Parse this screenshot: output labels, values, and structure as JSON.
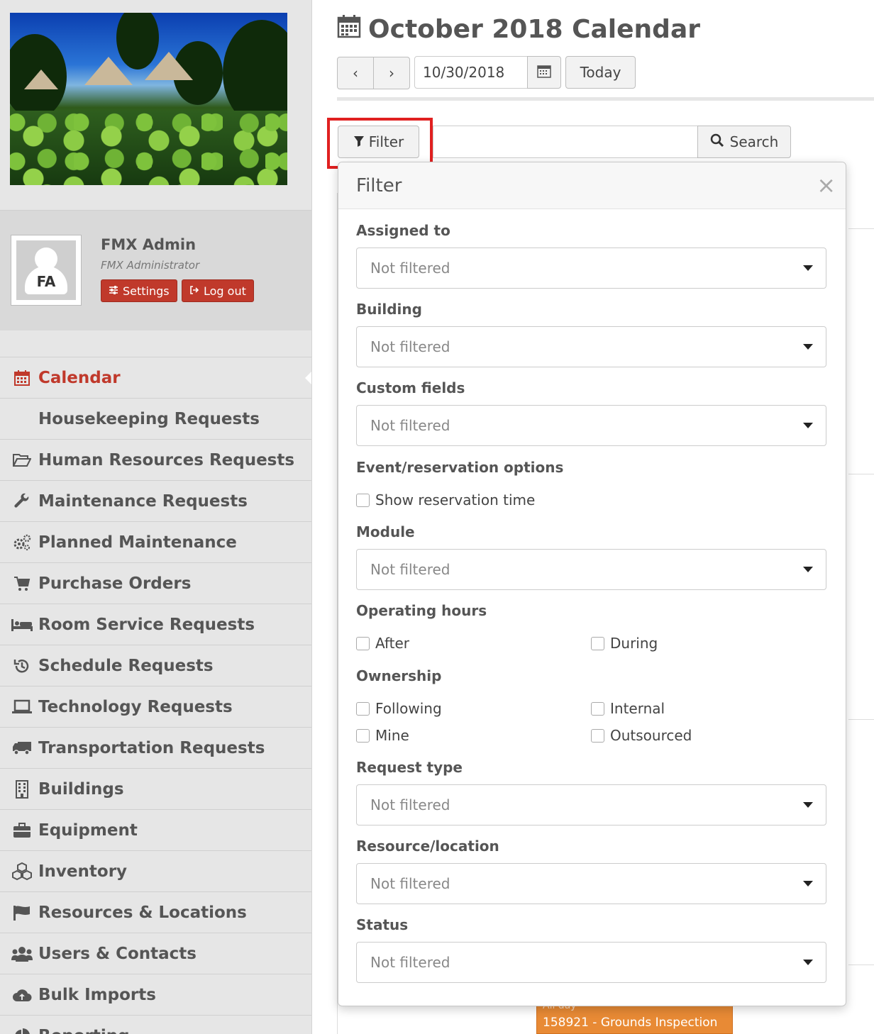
{
  "sidebar": {
    "user": {
      "initials": "FA",
      "name": "FMX Admin",
      "role": "FMX Administrator",
      "settings_label": "Settings",
      "logout_label": "Log out"
    },
    "nav": [
      {
        "label": "Calendar",
        "icon": "calendar-icon",
        "active": true
      },
      {
        "label": "Housekeeping Requests",
        "icon": "none",
        "sub": true
      },
      {
        "label": "Human Resources Requests",
        "icon": "folder-open-icon"
      },
      {
        "label": "Maintenance Requests",
        "icon": "wrench-icon"
      },
      {
        "label": "Planned Maintenance",
        "icon": "gears-icon"
      },
      {
        "label": "Purchase Orders",
        "icon": "cart-icon"
      },
      {
        "label": "Room Service Requests",
        "icon": "bed-icon"
      },
      {
        "label": "Schedule Requests",
        "icon": "history-icon"
      },
      {
        "label": "Technology Requests",
        "icon": "laptop-icon"
      },
      {
        "label": "Transportation Requests",
        "icon": "truck-icon"
      },
      {
        "label": "Buildings",
        "icon": "building-icon"
      },
      {
        "label": "Equipment",
        "icon": "briefcase-icon"
      },
      {
        "label": "Inventory",
        "icon": "cubes-icon"
      },
      {
        "label": "Resources & Locations",
        "icon": "flag-icon"
      },
      {
        "label": "Users & Contacts",
        "icon": "users-icon"
      },
      {
        "label": "Bulk Imports",
        "icon": "cloud-upload-icon"
      },
      {
        "label": "Reporting",
        "icon": "pie-chart-icon"
      }
    ]
  },
  "header": {
    "title": "October 2018 Calendar",
    "prev_label": "‹",
    "next_label": "›",
    "date_value": "10/30/2018",
    "today_label": "Today"
  },
  "toolbar": {
    "filter_label": "Filter",
    "search_label": "Search"
  },
  "filter_panel": {
    "title": "Filter",
    "close_label": "×",
    "assigned_to": {
      "label": "Assigned to",
      "value": "Not filtered"
    },
    "building": {
      "label": "Building",
      "value": "Not filtered"
    },
    "custom_fields": {
      "label": "Custom fields",
      "value": "Not filtered"
    },
    "event_options": {
      "label": "Event/reservation options",
      "show_reservation_time": "Show reservation time"
    },
    "module": {
      "label": "Module",
      "value": "Not filtered"
    },
    "operating_hours": {
      "label": "Operating hours",
      "after": "After",
      "during": "During"
    },
    "ownership": {
      "label": "Ownership",
      "following": "Following",
      "internal": "Internal",
      "mine": "Mine",
      "outsourced": "Outsourced"
    },
    "request_type": {
      "label": "Request type",
      "value": "Not filtered"
    },
    "resource_location": {
      "label": "Resource/location",
      "value": "Not filtered"
    },
    "status": {
      "label": "Status",
      "value": "Not filtered"
    }
  },
  "calendar_event": {
    "allday": "All day",
    "text": "158921 - Grounds Inspection"
  },
  "colors": {
    "accent": "#c0392b",
    "highlight": "#e02020",
    "event": "#e88a35"
  }
}
